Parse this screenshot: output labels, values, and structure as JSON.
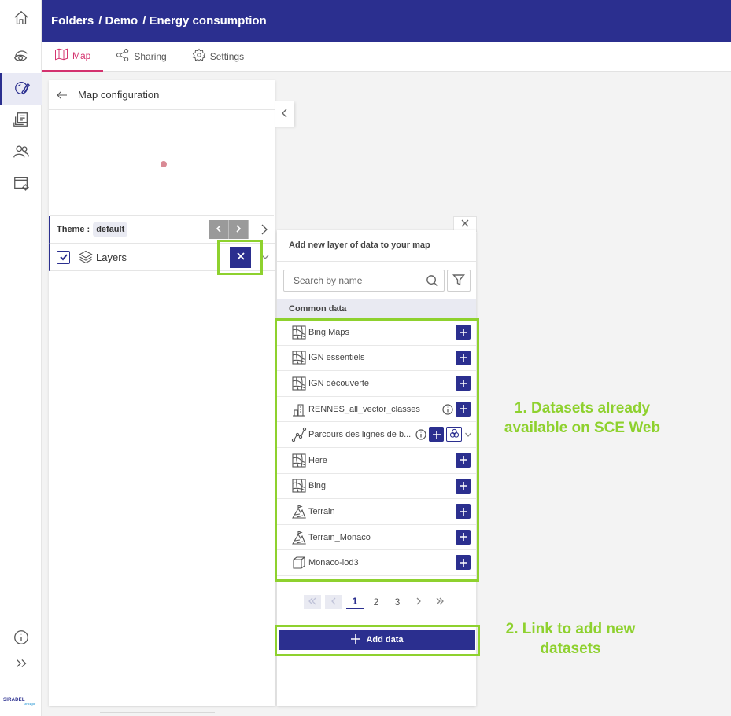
{
  "breadcrumb": [
    "Folders",
    "/ Demo",
    "/ Energy consumption"
  ],
  "tabs": [
    {
      "label": "Map",
      "icon": "map-icon",
      "active": true
    },
    {
      "label": "Sharing",
      "icon": "share-icon",
      "active": false
    },
    {
      "label": "Settings",
      "icon": "gear-icon",
      "active": false
    }
  ],
  "sidebar": {
    "icons": [
      "home-icon",
      "eye-icon",
      "brush-icon",
      "catalog-icon",
      "users-icon",
      "admin-icon",
      "info-icon",
      "expand-icon"
    ],
    "brand": "SIRADEL",
    "brand_sub": "Groupe"
  },
  "panel": {
    "title": "Map configuration",
    "theme_label": "Theme :",
    "theme_value": "default",
    "layers_label": "Layers"
  },
  "dialog": {
    "title": "Add new layer of data to your map",
    "search_placeholder": "Search by name",
    "section": "Common data",
    "items": [
      {
        "label": "Bing Maps",
        "icon": "basemap-icon"
      },
      {
        "label": "IGN essentiels",
        "icon": "basemap-icon"
      },
      {
        "label": "IGN découverte",
        "icon": "basemap-icon"
      },
      {
        "label": "RENNES_all_vector_classes",
        "icon": "buildings-icon",
        "info": true
      },
      {
        "label": "Parcours des lignes de b...",
        "icon": "polyline-icon",
        "info": true,
        "style": true
      },
      {
        "label": "Here",
        "icon": "basemap-icon"
      },
      {
        "label": "Bing",
        "icon": "basemap-icon"
      },
      {
        "label": "Terrain",
        "icon": "terrain-icon"
      },
      {
        "label": "Terrain_Monaco",
        "icon": "terrain-icon"
      },
      {
        "label": "Monaco-lod3",
        "icon": "cube-icon"
      }
    ],
    "pages": [
      "1",
      "2",
      "3"
    ],
    "current_page": "1",
    "add_label": "Add data"
  },
  "annotations": {
    "note1_line1": "1. Datasets already",
    "note1_line2": "available on SCE Web",
    "note2_line1": "2. Link to add new",
    "note2_line2": "datasets"
  },
  "colors": {
    "brand_blue": "#2b2f8f",
    "accent_pink": "#d4326e",
    "highlight_green": "#8ed12e"
  }
}
